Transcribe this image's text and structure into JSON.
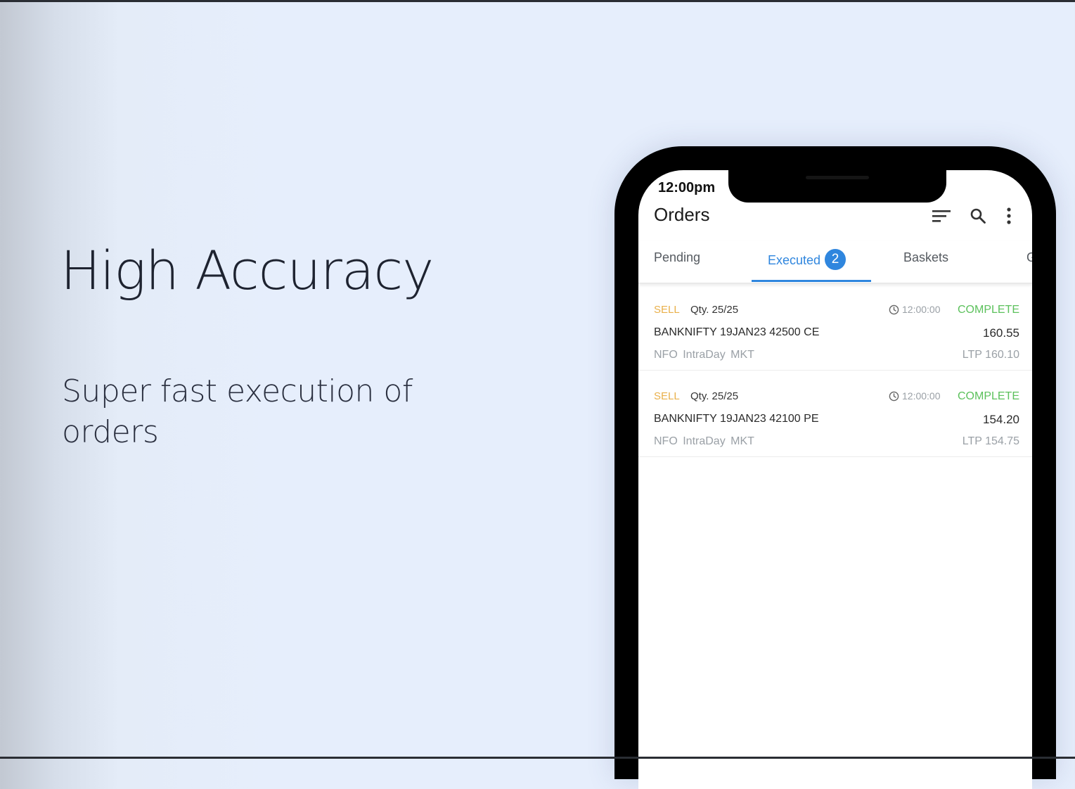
{
  "slide": {
    "headline": "High Accuracy",
    "subline": "Super fast execution of orders"
  },
  "phone": {
    "status_time": "12:00pm",
    "app_title": "Orders",
    "icons": [
      "filter-icon",
      "search-icon",
      "more-vertical-icon",
      "clock-icon"
    ],
    "accent_color": "#2f86de",
    "tabs": [
      {
        "label": "Pending",
        "active": false
      },
      {
        "label": "Executed",
        "active": true,
        "badge": "2"
      },
      {
        "label": "Baskets",
        "active": false
      },
      {
        "label": "G",
        "active": false
      }
    ],
    "orders": [
      {
        "side": "SELL",
        "qty": "Qty. 25/25",
        "time": "12:00:00",
        "status": "COMPLETE",
        "symbol": "BANKNIFTY 19JAN23 42500 CE",
        "price": "160.55",
        "meta": "NFO IntraDay MKT",
        "ltp": "LTP 160.10"
      },
      {
        "side": "SELL",
        "qty": "Qty. 25/25",
        "time": "12:00:00",
        "status": "COMPLETE",
        "symbol": "BANKNIFTY 19JAN23 42100 PE",
        "price": "154.20",
        "meta": "NFO IntraDay MKT",
        "ltp": "LTP 154.75"
      }
    ]
  }
}
